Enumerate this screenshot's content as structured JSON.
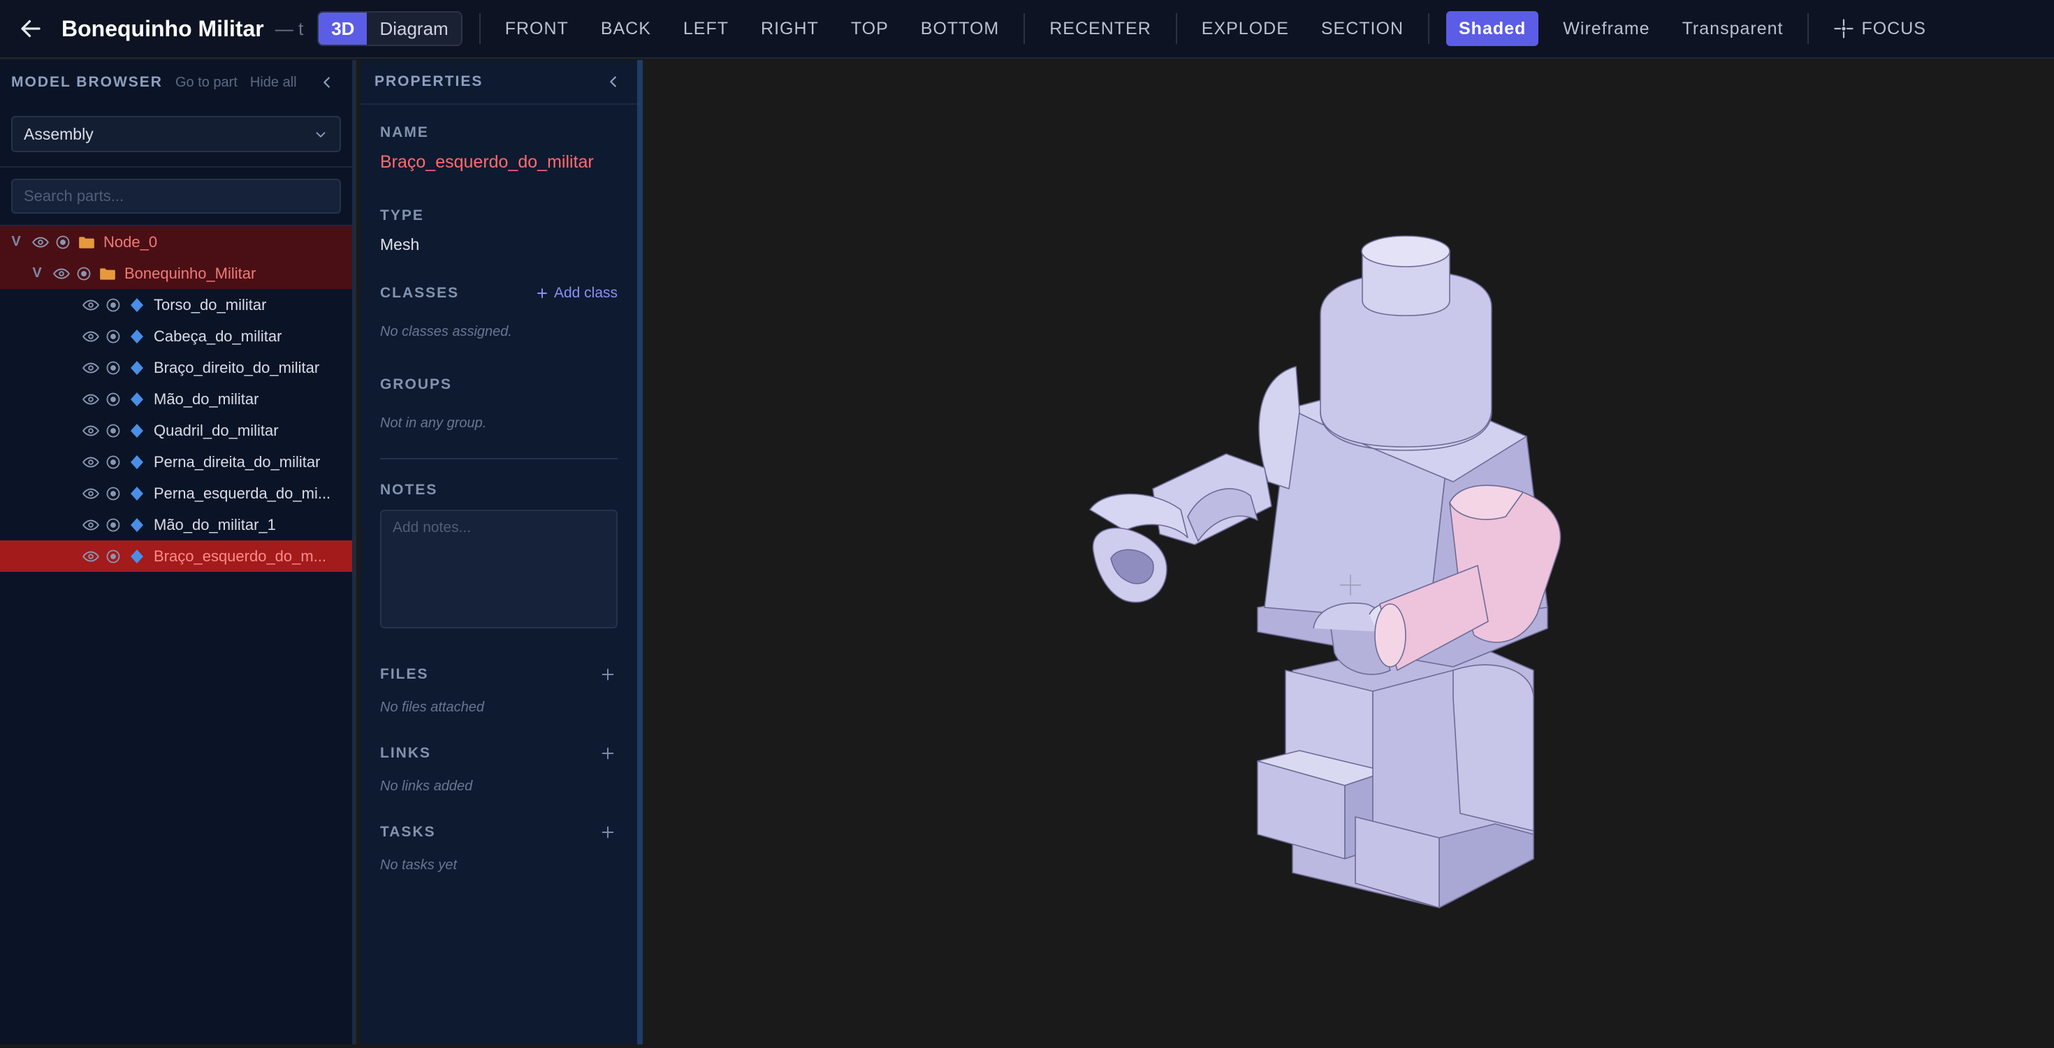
{
  "header": {
    "title": "Bonequinho Militar",
    "subtitle": "— t",
    "view_modes": [
      {
        "label": "3D",
        "active": true
      },
      {
        "label": "Diagram",
        "active": false
      }
    ],
    "views": [
      "FRONT",
      "BACK",
      "LEFT",
      "RIGHT",
      "TOP",
      "BOTTOM"
    ],
    "recenter": "RECENTER",
    "explode": "EXPLODE",
    "section": "SECTION",
    "render_modes": [
      {
        "label": "Shaded",
        "active": true
      },
      {
        "label": "Wireframe",
        "active": false
      },
      {
        "label": "Transparent",
        "active": false
      }
    ],
    "focus": "FOCUS",
    "accent": "#5b5de6"
  },
  "browser": {
    "title": "MODEL BROWSER",
    "go_to_part": "Go to part",
    "hide_all": "Hide all",
    "assembly_select": "Assembly",
    "search_placeholder": "Search parts...",
    "tree": [
      {
        "label": "Node_0",
        "type": "folder",
        "level": 0,
        "expanded": true,
        "state": "parent"
      },
      {
        "label": "Bonequinho_Militar",
        "type": "folder",
        "level": 1,
        "expanded": true,
        "state": "parent"
      },
      {
        "label": "Torso_do_militar",
        "type": "mesh",
        "level": 2,
        "state": "normal"
      },
      {
        "label": "Cabeça_do_militar",
        "type": "mesh",
        "level": 2,
        "state": "normal"
      },
      {
        "label": "Braço_direito_do_militar",
        "type": "mesh",
        "level": 2,
        "state": "normal"
      },
      {
        "label": "Mão_do_militar",
        "type": "mesh",
        "level": 2,
        "state": "normal"
      },
      {
        "label": "Quadril_do_militar",
        "type": "mesh",
        "level": 2,
        "state": "normal"
      },
      {
        "label": "Perna_direita_do_militar",
        "type": "mesh",
        "level": 2,
        "state": "normal"
      },
      {
        "label": "Perna_esquerda_do_mi...",
        "type": "mesh",
        "level": 2,
        "state": "normal"
      },
      {
        "label": "Mão_do_militar_1",
        "type": "mesh",
        "level": 2,
        "state": "normal"
      },
      {
        "label": "Braço_esquerdo_do_m...",
        "type": "mesh",
        "level": 2,
        "state": "selected"
      }
    ],
    "toggle_glyph": "V"
  },
  "properties": {
    "title": "PROPERTIES",
    "name_label": "NAME",
    "name_value": "Braço_esquerdo_do_militar",
    "type_label": "TYPE",
    "type_value": "Mesh",
    "classes_label": "CLASSES",
    "add_class": "Add class",
    "classes_empty": "No classes assigned.",
    "groups_label": "GROUPS",
    "groups_empty": "Not in any group.",
    "notes_label": "NOTES",
    "notes_placeholder": "Add notes...",
    "files_label": "FILES",
    "files_empty": "No files attached",
    "links_label": "LINKS",
    "links_empty": "No links added",
    "tasks_label": "TASKS",
    "tasks_empty": "No tasks yet"
  },
  "colors": {
    "model": "#c7c6e8",
    "selected_part": "#eec3dc",
    "selection_red": "#a31b1b"
  }
}
